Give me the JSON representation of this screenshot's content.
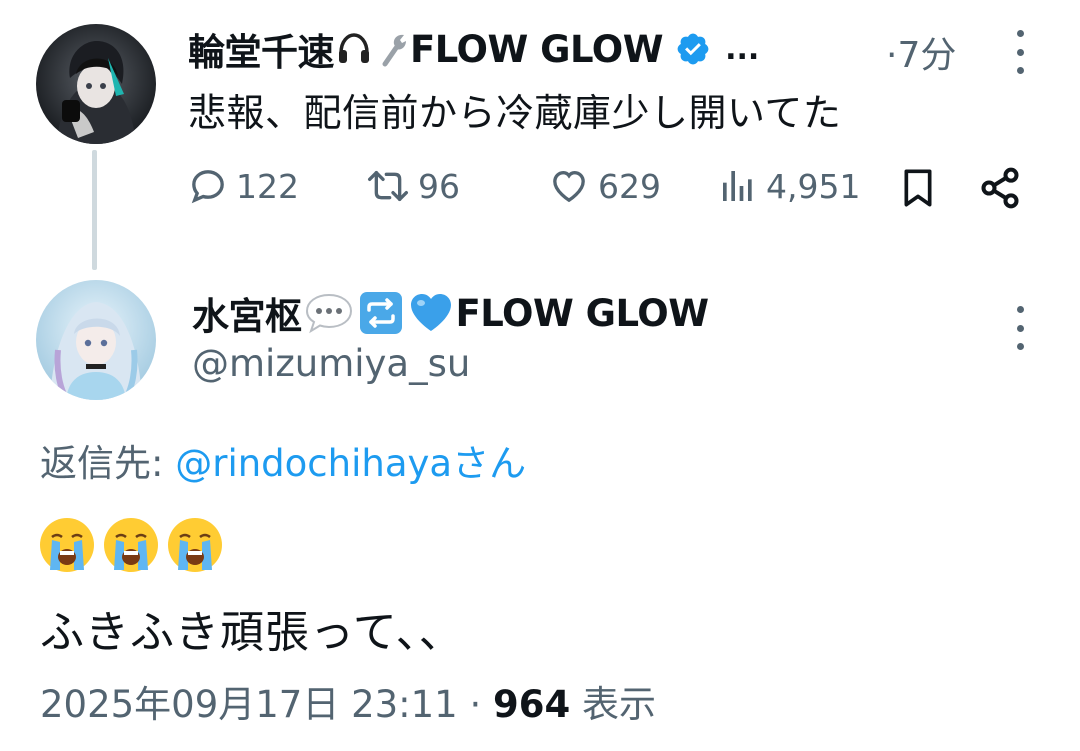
{
  "parent_tweet": {
    "author_name": "輪堂千速",
    "author_suffix": "FLOW GLOW",
    "name_overflow": "...",
    "time": "·7分",
    "text": "悲報、配信前から冷蔵庫少し開いてた",
    "icons": [
      "headphones-icon",
      "wrench-icon",
      "verified-badge-icon",
      "more-icon"
    ],
    "actions": {
      "replies": "122",
      "reposts": "96",
      "likes": "629",
      "views": "4,951"
    }
  },
  "reply_tweet": {
    "author_name": "水宮枢",
    "author_suffix": "FLOW GLOW",
    "name_icons": [
      "speech-bubble-icon",
      "repeat-icon",
      "blue-heart-icon"
    ],
    "handle": "@mizumiya_su",
    "reply_to_label": "返信先:",
    "reply_to_mention": "@rindochihaya",
    "reply_to_suffix": "さん",
    "emojis": [
      "crying-face-icon",
      "crying-face-icon",
      "crying-face-icon"
    ],
    "text": "ふきふき頑張って、、",
    "date": "2025年09月17日 23:11",
    "separator": "·",
    "views_count": "964",
    "views_label": "表示"
  },
  "colors": {
    "text_primary": "#0f1419",
    "text_secondary": "#536471",
    "link": "#1d9bf0",
    "verified": "#1d9bf0",
    "thread_line": "#cfd9de"
  }
}
